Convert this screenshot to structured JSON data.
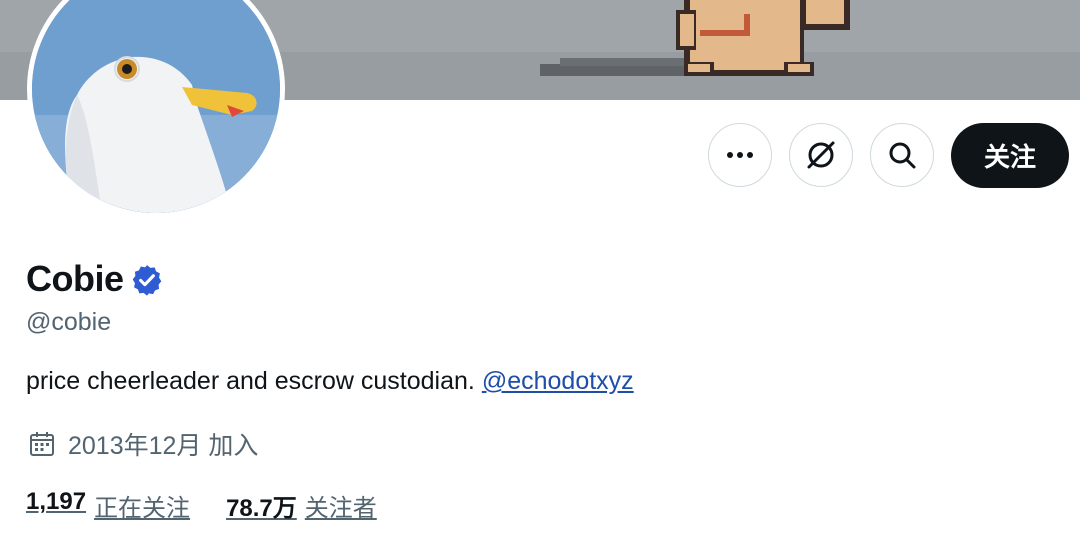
{
  "profile": {
    "display_name": "Cobie",
    "handle": "@cobie",
    "verified": true,
    "bio_text": "price cheerleader and escrow custodian.",
    "bio_mention": "@echodotxyz",
    "joined": "2013年12月 加入"
  },
  "stats": {
    "following_count": "1,197",
    "following_label": "正在关注",
    "followers_count": "78.7万",
    "followers_label": "关注者"
  },
  "actions": {
    "follow_label": "关注",
    "more_icon": "more-horizontal-icon",
    "grok_icon": "grok-icon",
    "search_icon": "search-icon"
  },
  "colors": {
    "follow_bg": "#0f1419",
    "verified_blue": "#2f5bd3",
    "link": "#1d4ea8",
    "secondary_text": "#536471"
  }
}
